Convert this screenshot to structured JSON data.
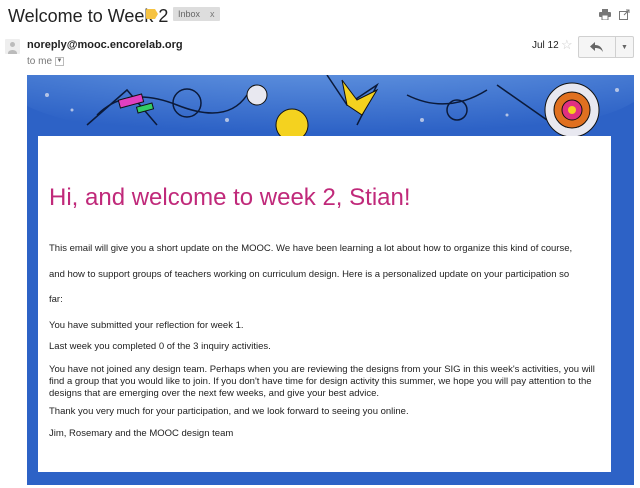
{
  "email": {
    "subject": "Welcome to Week 2",
    "label": "Inbox",
    "label_remove": "x",
    "sender": "noreply@mooc.encorelab.org",
    "recipient": "to me",
    "date": "Jul 12"
  },
  "icons": {
    "print": "print-icon",
    "popout": "popout-icon",
    "star": "star-icon",
    "reply": "reply-icon",
    "more": "dropdown-icon"
  },
  "colors": {
    "frame": "#2d62c6",
    "headline": "#c0297a",
    "label_tag": "#f6c342"
  },
  "body": {
    "headline": "Hi, and welcome to week 2, Stian!",
    "para1_line1": "This email will give you a short update on the MOOC. We have been learning a lot about how to organize this kind of course,",
    "para1_line2": "and how to support groups of teachers working on curriculum design. Here is a personalized update on your participation so",
    "para1_line3": "far:",
    "reflection": "You have submitted your reflection for week 1.",
    "inquiry": "Last week you completed 0 of the 3 inquiry activities.",
    "design_team": "You have not joined any design team. Perhaps when you are reviewing the designs from your SIG in this week's activities, you will find a group that you would like to join. If you don't have time for design activity this summer, we hope you will pay attention to the designs that are emerging over the next few weeks, and give your best advice.",
    "thanks": "Thank you very much for your participation, and we look forward to seeing you online.",
    "signature": "Jim, Rosemary and the MOOC design team"
  }
}
